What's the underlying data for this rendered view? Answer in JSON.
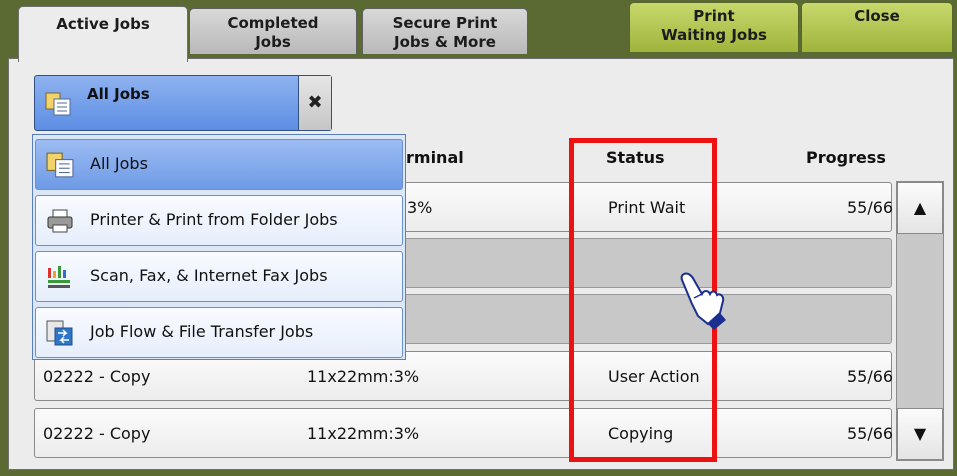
{
  "tabs": {
    "active_jobs": "Active Jobs",
    "completed_line1": "Completed",
    "completed_line2": "Jobs",
    "secure_line1": "Secure Print",
    "secure_line2": "Jobs & More",
    "print_waiting_line1": "Print",
    "print_waiting_line2": "Waiting Jobs",
    "close": "Close"
  },
  "filter": {
    "selected": "All Jobs",
    "close_glyph": "✖"
  },
  "dropdown": {
    "items": [
      {
        "label": "All Jobs",
        "icon": "all-jobs-icon"
      },
      {
        "label": "Printer & Print from Folder Jobs",
        "icon": "printer-icon"
      },
      {
        "label": "Scan, Fax, & Internet Fax Jobs",
        "icon": "scan-fax-icon"
      },
      {
        "label": "Job Flow & File Transfer Jobs",
        "icon": "job-flow-icon"
      }
    ]
  },
  "table": {
    "headers": {
      "terminal_partial": "rminal",
      "status": "Status",
      "progress": "Progress"
    },
    "rows": [
      {
        "name": "",
        "terminal": "3%",
        "status": "Print Wait",
        "progress": "55/66"
      },
      {
        "name": "",
        "terminal": "",
        "status": "",
        "progress": ""
      },
      {
        "name": "",
        "terminal": "",
        "status": "",
        "progress": ""
      },
      {
        "name": "02222 - Copy",
        "terminal": "11x22mm:3%",
        "status": "User Action",
        "progress": "55/66"
      },
      {
        "name": "02222 - Copy",
        "terminal": "11x22mm:3%",
        "status": "Copying",
        "progress": "55/66"
      }
    ]
  },
  "scroll": {
    "up": "▲",
    "down": "▼"
  },
  "colors": {
    "accent_blue": "#6e9be6",
    "highlight_red": "#ee1111",
    "frame_green": "#5a6a32",
    "tab_green": "#9fb43c"
  }
}
